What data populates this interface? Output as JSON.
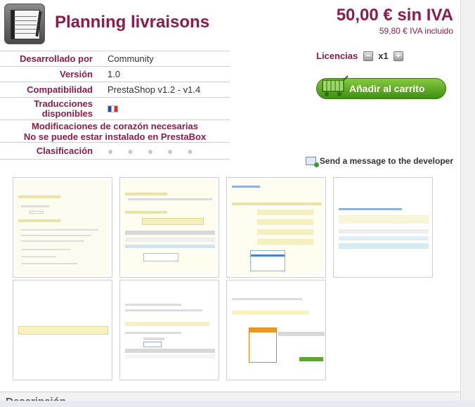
{
  "product": {
    "title": "Planning livraisons",
    "icon": "planner-book-icon"
  },
  "price": {
    "main": "50,00 € sin IVA",
    "with_tax": "59,80 € IVA incluido"
  },
  "info": {
    "developer_label": "Desarrollado por",
    "developer_value": "Community",
    "version_label": "Versión",
    "version_value": "1.0",
    "compat_label": "Compatibilidad",
    "compat_value": "PrestaShop v1.2 - v1.4",
    "translations_label_1": "Traducciones",
    "translations_label_2": "disponibles",
    "translations_flag": "flag-france-icon",
    "core_mods": "Modificaciones de corazón necesarias",
    "not_prestabox": "No se puede estar instalado en PrestaBox",
    "rating_label": "Clasificación",
    "rating_dots": "● ● ● ● ●"
  },
  "purchase": {
    "licences_label": "Licencias",
    "minus": "−",
    "qty": "x1",
    "plus": "+",
    "add_to_cart": "Añadir al carrito"
  },
  "contact": {
    "send_message": "Send a message to the developer"
  },
  "screenshots": [
    {
      "name": "screenshot-1",
      "accent": "#f3f0c8"
    },
    {
      "name": "screenshot-2",
      "accent": "#f3f0c8"
    },
    {
      "name": "screenshot-3",
      "accent": "#f3f0c8"
    },
    {
      "name": "screenshot-4",
      "accent": "#e6f2f8"
    },
    {
      "name": "screenshot-5",
      "accent": "#f3f0c8"
    },
    {
      "name": "screenshot-6",
      "accent": "#f3f0c8"
    },
    {
      "name": "screenshot-7",
      "accent": "#f3f0c8"
    }
  ],
  "description_header": "Descripción",
  "colors": {
    "brand": "#8c1d4b",
    "cart_green": "#5aa825"
  }
}
